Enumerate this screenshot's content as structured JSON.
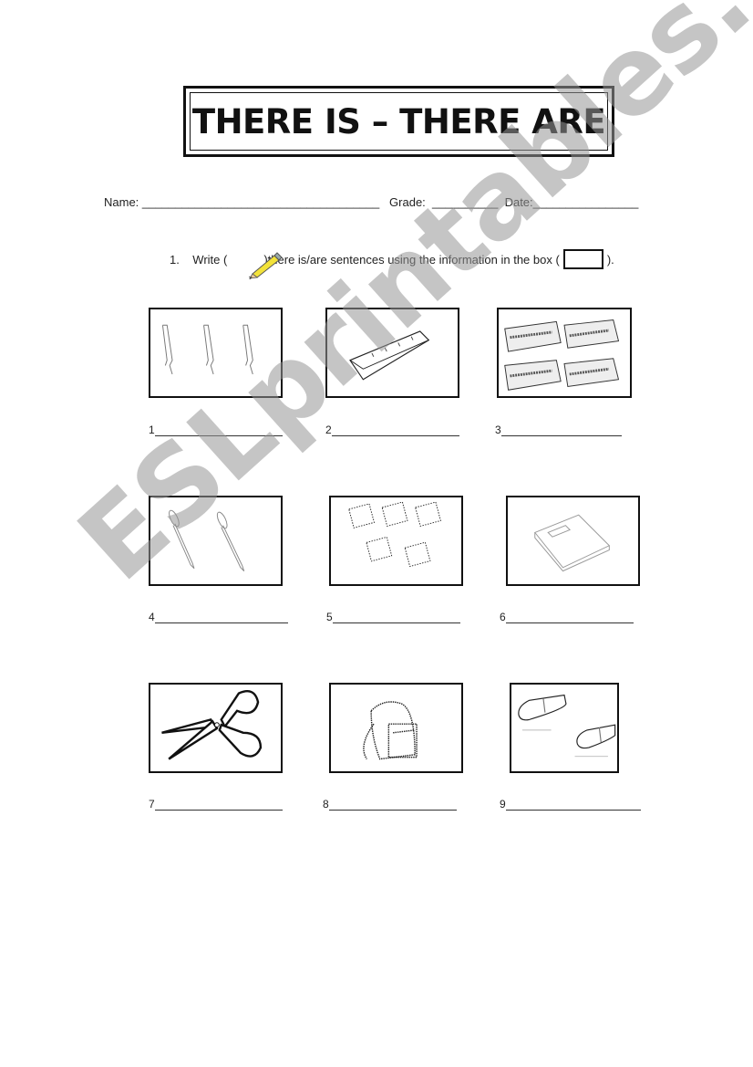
{
  "title": "THERE IS – THERE ARE",
  "info": {
    "name_label": "Name:",
    "name_blank": "____________________________________",
    "grade_label": "Grade:",
    "grade_blank": "__________",
    "date_label": "Date:",
    "date_blank": "________________"
  },
  "instruction": {
    "number": "1.",
    "prefix": "Write (",
    "icon": "pencil-icon",
    "middle": ")there is/are sentences using the information in the box (",
    "suffix": ")."
  },
  "items": [
    {
      "number": "1",
      "picture": "three pens",
      "icon": "pen-icon"
    },
    {
      "number": "2",
      "picture": "a ruler",
      "icon": "ruler-icon"
    },
    {
      "number": "3",
      "picture": "four pencil cases",
      "icon": "pencil-case-icon"
    },
    {
      "number": "4",
      "picture": "two pencils",
      "icon": "pencil-icon"
    },
    {
      "number": "5",
      "picture": "five sharpeners",
      "icon": "sharpener-icon"
    },
    {
      "number": "6",
      "picture": "a notebook",
      "icon": "notebook-icon"
    },
    {
      "number": "7",
      "picture": "a pair of scissors",
      "icon": "scissors-icon"
    },
    {
      "number": "8",
      "picture": "a backpack",
      "icon": "backpack-icon"
    },
    {
      "number": "9",
      "picture": "two erasers",
      "icon": "eraser-icon"
    }
  ],
  "watermark": "ESLprintables.com"
}
